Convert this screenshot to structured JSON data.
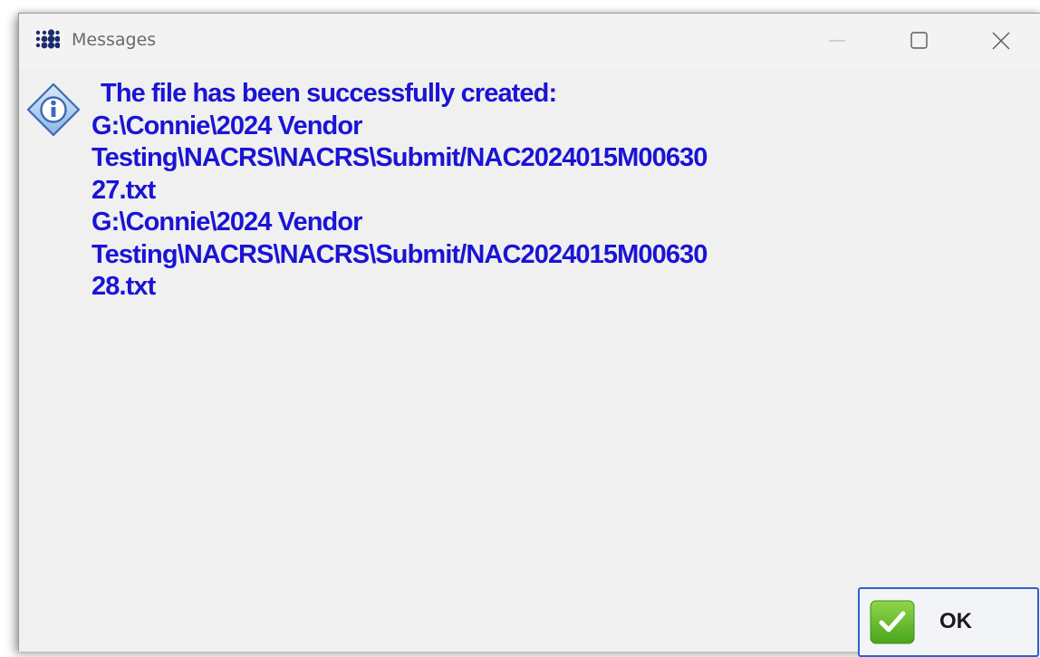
{
  "window": {
    "title": "Messages",
    "app_icon": "grid-dots-icon",
    "controls": {
      "minimize": "minimize-icon",
      "maximize": "maximize-icon",
      "close": "close-icon"
    }
  },
  "message": {
    "icon": "info-icon",
    "lines": [
      "The file has been successfully created:",
      "G:\\Connie\\2024 Vendor",
      "Testing\\NACRS\\NACRS\\Submit/NAC2024015M00630",
      "27.txt",
      "G:\\Connie\\2024 Vendor",
      "Testing\\NACRS\\NACRS\\Submit/NAC2024015M00630",
      "28.txt"
    ],
    "color": "#1a14d4"
  },
  "ok_button": {
    "label": "OK",
    "icon": "checkmark-icon",
    "accent": "#5cb82a",
    "border": "#2b63c9"
  }
}
